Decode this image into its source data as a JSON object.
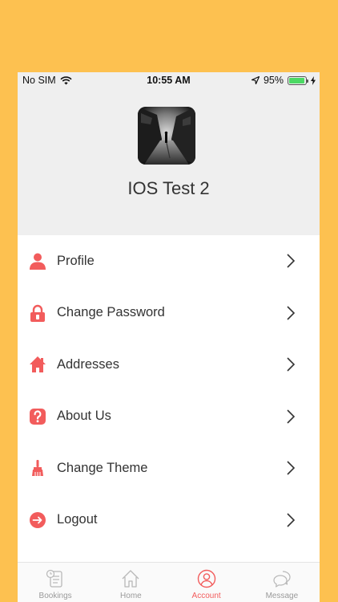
{
  "status_bar": {
    "carrier": "No SIM",
    "time": "10:55 AM",
    "battery_percent": "95%",
    "battery_level": 0.95
  },
  "profile": {
    "name": "IOS Test 2"
  },
  "menu": {
    "items": [
      {
        "label": "Profile",
        "icon": "person-icon"
      },
      {
        "label": "Change Password",
        "icon": "lock-icon"
      },
      {
        "label": "Addresses",
        "icon": "home-icon"
      },
      {
        "label": "About Us",
        "icon": "question-icon"
      },
      {
        "label": "Change Theme",
        "icon": "brush-icon"
      },
      {
        "label": "Logout",
        "icon": "logout-icon"
      }
    ]
  },
  "tab_bar": {
    "tabs": [
      {
        "label": "Bookings",
        "icon": "bookings-icon",
        "active": false
      },
      {
        "label": "Home",
        "icon": "home-icon",
        "active": false
      },
      {
        "label": "Account",
        "icon": "account-icon",
        "active": true
      },
      {
        "label": "Message",
        "icon": "message-icon",
        "active": false
      }
    ]
  },
  "colors": {
    "background": "#FDC150",
    "accent": "#F25C5C",
    "header": "#EFEFEF"
  }
}
